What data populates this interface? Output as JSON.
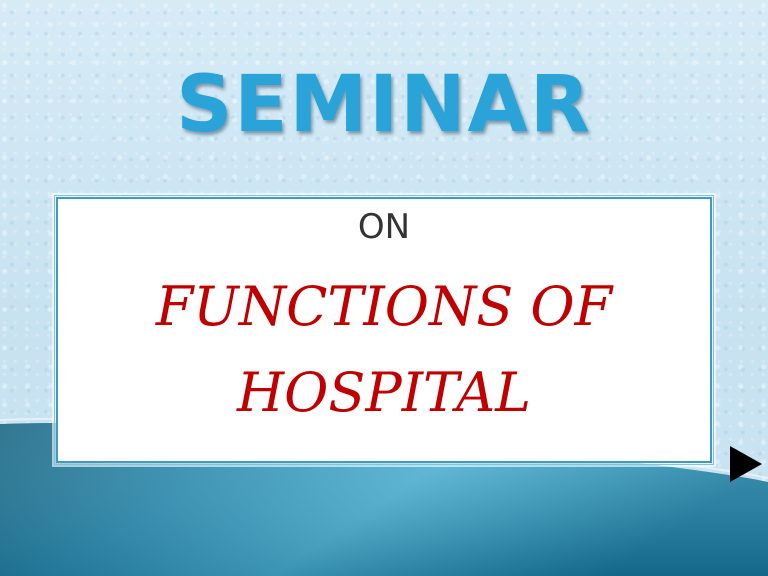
{
  "slide": {
    "title": "SEMINAR",
    "subtitle": "ON",
    "topic_line_1": "FUNCTIONS OF",
    "topic_line_2": "HOSPITAL"
  },
  "colors": {
    "background": "#cfe6f3",
    "title": "#2aa3d8",
    "subtitle": "#333333",
    "topic": "#c00000",
    "box_border": "#3d9cc3",
    "band_dark": "#0e5f7d",
    "band_light": "#4db6d9",
    "arrow": "#000000"
  },
  "icons": [
    "arrow-triangle-icon"
  ]
}
